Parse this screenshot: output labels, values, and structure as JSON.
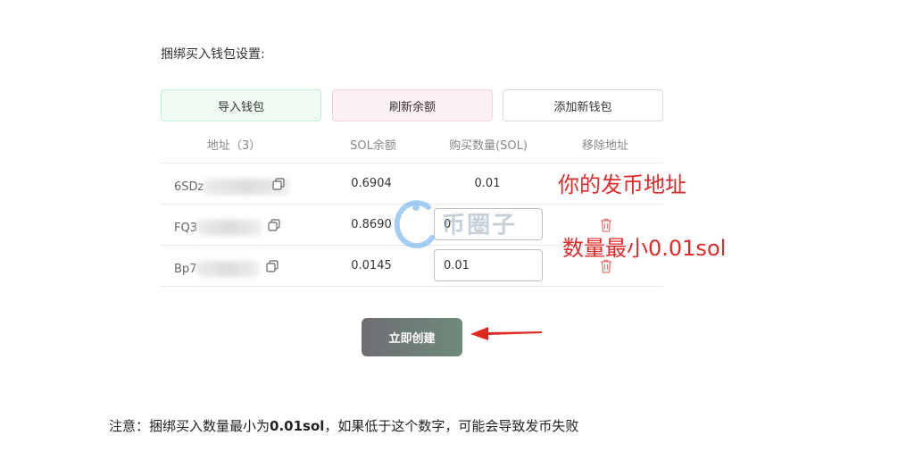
{
  "section_title": "捆绑买入钱包设置:",
  "buttons": {
    "import": "导入钱包",
    "refresh": "刷新余额",
    "add": "添加新钱包"
  },
  "table": {
    "headers": [
      "地址（3）",
      "SOL余额",
      "购买数量(SOL)",
      "移除地址"
    ],
    "rows": [
      {
        "address_prefix": "6SDz",
        "balance": "0.6904",
        "amount": "0.01"
      },
      {
        "address_prefix": "FQ3",
        "balance": "0.8690",
        "amount": "0"
      },
      {
        "address_prefix": "Bp7",
        "balance": "0.0145",
        "amount": "0.01"
      }
    ]
  },
  "create_button": "立即创建",
  "annotations": {
    "issue_address": "你的发币地址",
    "min_amount": "数量最小0.01sol"
  },
  "note": {
    "prefix": "注意：捆绑买入数量最小为",
    "highlight": "0.01sol",
    "suffix": "，如果低于这个数字，可能会导致发币失败"
  },
  "watermark": "币圈子",
  "colors": {
    "annotation_red": "#e02b2b",
    "delete_icon": "#e57373"
  }
}
